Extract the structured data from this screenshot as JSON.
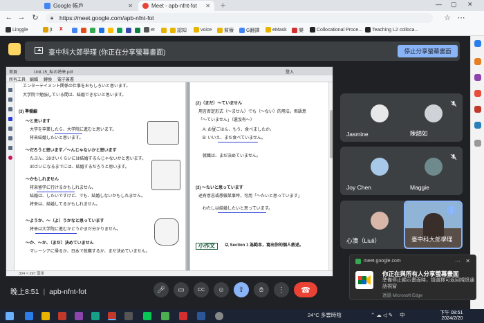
{
  "browser": {
    "tabs": [
      {
        "label": "Google 帳戶"
      },
      {
        "label": "Meet - apb-nfnt-fot"
      }
    ],
    "url": "https://meet.google.com/apb-nfnt-fot",
    "bookmarks": [
      "Linggle",
      "jt",
      "X",
      "et",
      "認知",
      "voice",
      "貧療",
      "G翻譯",
      "eMask",
      "樂",
      "Collocational Proce...",
      "Teaching L2 colloca..."
    ]
  },
  "meet": {
    "share_banner": "臺中科大郎學瑾 (你正在分享螢幕畫面)",
    "stop_share_label": "停止分享螢幕畫面",
    "time": "晚上8:51",
    "meeting_code": "apb-nfnt-fot",
    "participants": [
      {
        "name": "Jasmine",
        "muted": true
      },
      {
        "name": "陳韻如",
        "muted": true
      },
      {
        "name": "Joy Chen",
        "muted": true
      },
      {
        "name": "Maggie",
        "muted": true
      },
      {
        "name": "心潰（Liuli）",
        "muted": true
      },
      {
        "name": "臺中科大郎學瑾",
        "muted": false
      }
    ],
    "controls": [
      "mic-icon",
      "camera-icon",
      "captions-icon",
      "emoji-icon",
      "present-icon",
      "hand-icon",
      "more-icon",
      "hangup-icon"
    ]
  },
  "shared_pdf": {
    "title_left": "首頁",
    "title_file": "Unit.15_私の将来.pdf",
    "menu": [
      "所有工具",
      "編輯",
      "轉換",
      "電子簽署"
    ],
    "sign_in": "登入",
    "left_lines": [
      "エンターテイメント関係の仕事をおもしろいと思います。",
      "大学院で勉強している間は、結婚できないと思います。",
      "(3) 準備編",
      "～と思います",
      "大学を卒業したら、大学院に進むと思います。",
      "将来結婚したいと思います。",
      "～だろうと思います／～んじゃないかと思います",
      "たぶん、28さいくらいには結婚するんじゃないかと思います。",
      "30さいになるまでには、結婚するだろうと思います。",
      "～かもしれません",
      "将来留学に行けるかもしれません。",
      "結婚は、したいですけど、でも、結婚しないかもしれません。",
      "将来は、結婚してるかもしれません。",
      "～ようか、～（よ）うかなと思っています",
      "将来は大学院に進むかどうかまだ分かりません。",
      "～か、～か、（まだ）決めていません",
      "マレーシアに帰るか、日本で就職するか、まだ決めていません。"
    ],
    "right_lines": [
      "(2)（まだ）～ていません",
      "用言否定形式（～ません）でも（〜ない）的用法，但語意",
      "「～ていません」（還沒有～）",
      "A: お昼ごはん、もう、食べましたか。",
      "B: いいえ、まだ食べていません。",
      "就職は、まだ決めていません。",
      "(3) ～たいと思っています",
      "述有意志或想做某事時，可用「～たいと思っています」",
      "わたしは結婚したいと思っています。",
      "小作文",
      "以 Section 1 為範本，寫出你的個人敘述。"
    ],
    "status": "304 × 297 毫米"
  },
  "toast": {
    "source": "meet.google.com",
    "title": "你正在與所有人分享螢幕畫面",
    "body": "準備停止顯示畫面時，請選擇可返回視訊通話視窗",
    "via": "透過 Microsoft Edge"
  },
  "taskbar": {
    "weather": "24°C 多雲時陰",
    "lang": "中",
    "time": "下午 08:51",
    "date": "2024/2/20"
  }
}
